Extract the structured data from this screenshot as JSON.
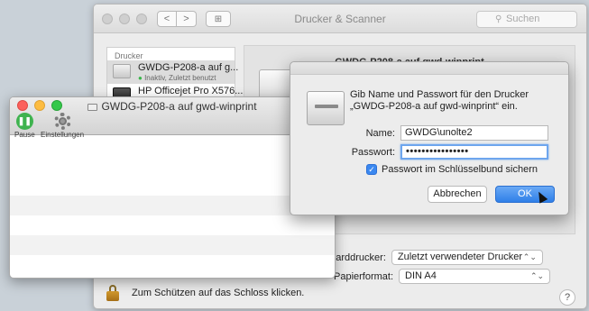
{
  "main_window": {
    "title": "Drucker & Scanner",
    "nav_back": "<",
    "nav_forward": ">",
    "grid_symbol": "⊞",
    "search_placeholder": "Suchen",
    "list_header": "Drucker",
    "printers": [
      {
        "name": "GWDG-P208-a auf g...",
        "status": "Inaktiv, Zuletzt benutzt",
        "status_dot": "●"
      },
      {
        "name": "HP Officejet Pro X576..."
      }
    ],
    "detail_title": "GWDG-P208-a auf gwd-winprint",
    "default_printer_label": "ndarddrucker:",
    "default_printer_value": "Zuletzt verwendeter Drucker",
    "paper_label": "Papierformat:",
    "paper_value": "DIN A4",
    "popup_arrow": "⌃⌄",
    "lock_text": "Zum Schützen auf das Schloss klicken.",
    "help_label": "?"
  },
  "queue_window": {
    "title": "GWDG-P208-a auf gwd-winprint",
    "pause_label": "Pause",
    "settings_label": "Einstellungen",
    "pause_glyph": "❚❚"
  },
  "auth_dialog": {
    "message": "Gib Name und Passwort für den Drucker „GWDG-P208-a auf gwd-winprint“ ein.",
    "name_label": "Name:",
    "name_value": "GWDG\\unolte2",
    "password_label": "Passwort:",
    "password_value": "••••••••••••••••",
    "keychain_label": "Passwort im Schlüsselbund sichern",
    "keychain_checked": true,
    "check_glyph": "✓",
    "cancel_label": "Abbrechen",
    "ok_label": "OK"
  },
  "colors": {
    "accent_blue": "#2f7fe8",
    "status_green": "#39b54a",
    "close_red": "#fc605c",
    "minimize_yellow": "#fdbc40",
    "zoom_green": "#34c84a"
  },
  "icons": {
    "search": "search-icon",
    "lock": "lock-icon",
    "pause": "pause-icon",
    "settings": "gear-icon",
    "printer": "printer-icon"
  }
}
